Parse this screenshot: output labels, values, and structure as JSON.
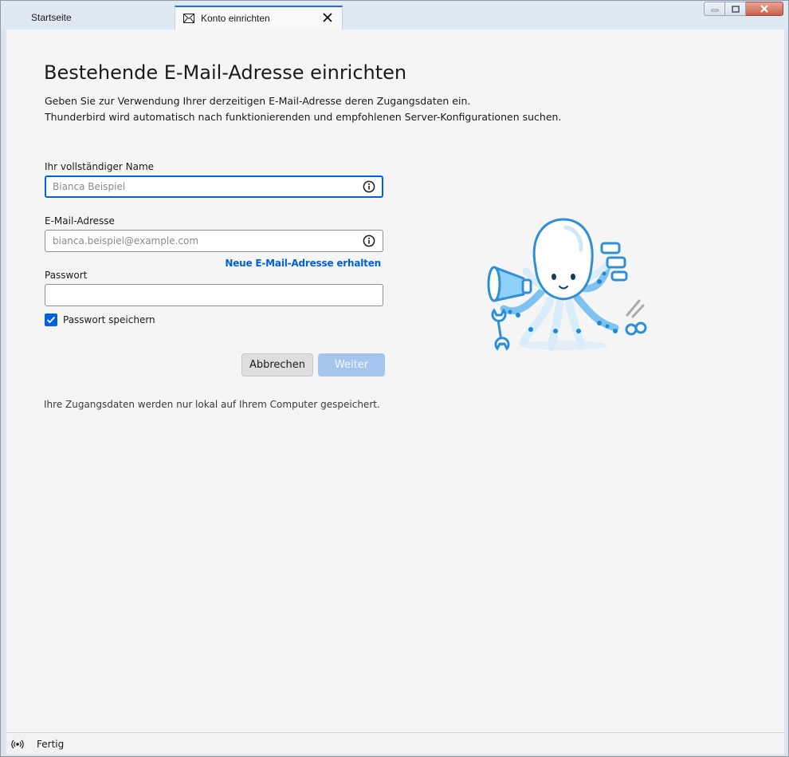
{
  "tabs": [
    {
      "label": "Startseite"
    },
    {
      "label": "Konto einrichten",
      "icon": "mail-icon"
    }
  ],
  "window_controls": [
    "minimize-icon",
    "maximize-icon",
    "close-icon"
  ],
  "page": {
    "title": "Bestehende E-Mail-Adresse einrichten",
    "description_line1": "Geben Sie zur Verwendung Ihrer derzeitigen E-Mail-Adresse deren Zugangsdaten ein.",
    "description_line2": "Thunderbird wird automatisch nach funktionierenden und empfohlenen Server-Konfigurationen suchen."
  },
  "form": {
    "name_label": "Ihr vollständiger Name",
    "name_placeholder": "Bianca Beispiel",
    "name_value": "",
    "email_label": "E-Mail-Adresse",
    "email_placeholder": "bianca.beispiel@example.com",
    "email_value": "",
    "new_email_link": "Neue E-Mail-Adresse erhalten",
    "password_label": "Passwort",
    "password_value": "",
    "remember_password_label": "Passwort speichern",
    "remember_password_checked": true,
    "cancel_label": "Abbrechen",
    "next_label": "Weiter",
    "footnote": "Ihre Zugangsdaten werden nur lokal auf Ihrem Computer gespeichert."
  },
  "status": {
    "text": "Fertig",
    "icon": "online-icon"
  },
  "colors": {
    "accent": "#0060df",
    "next_disabled": "#a3c5ee",
    "content_bg": "#f5f5f6"
  }
}
